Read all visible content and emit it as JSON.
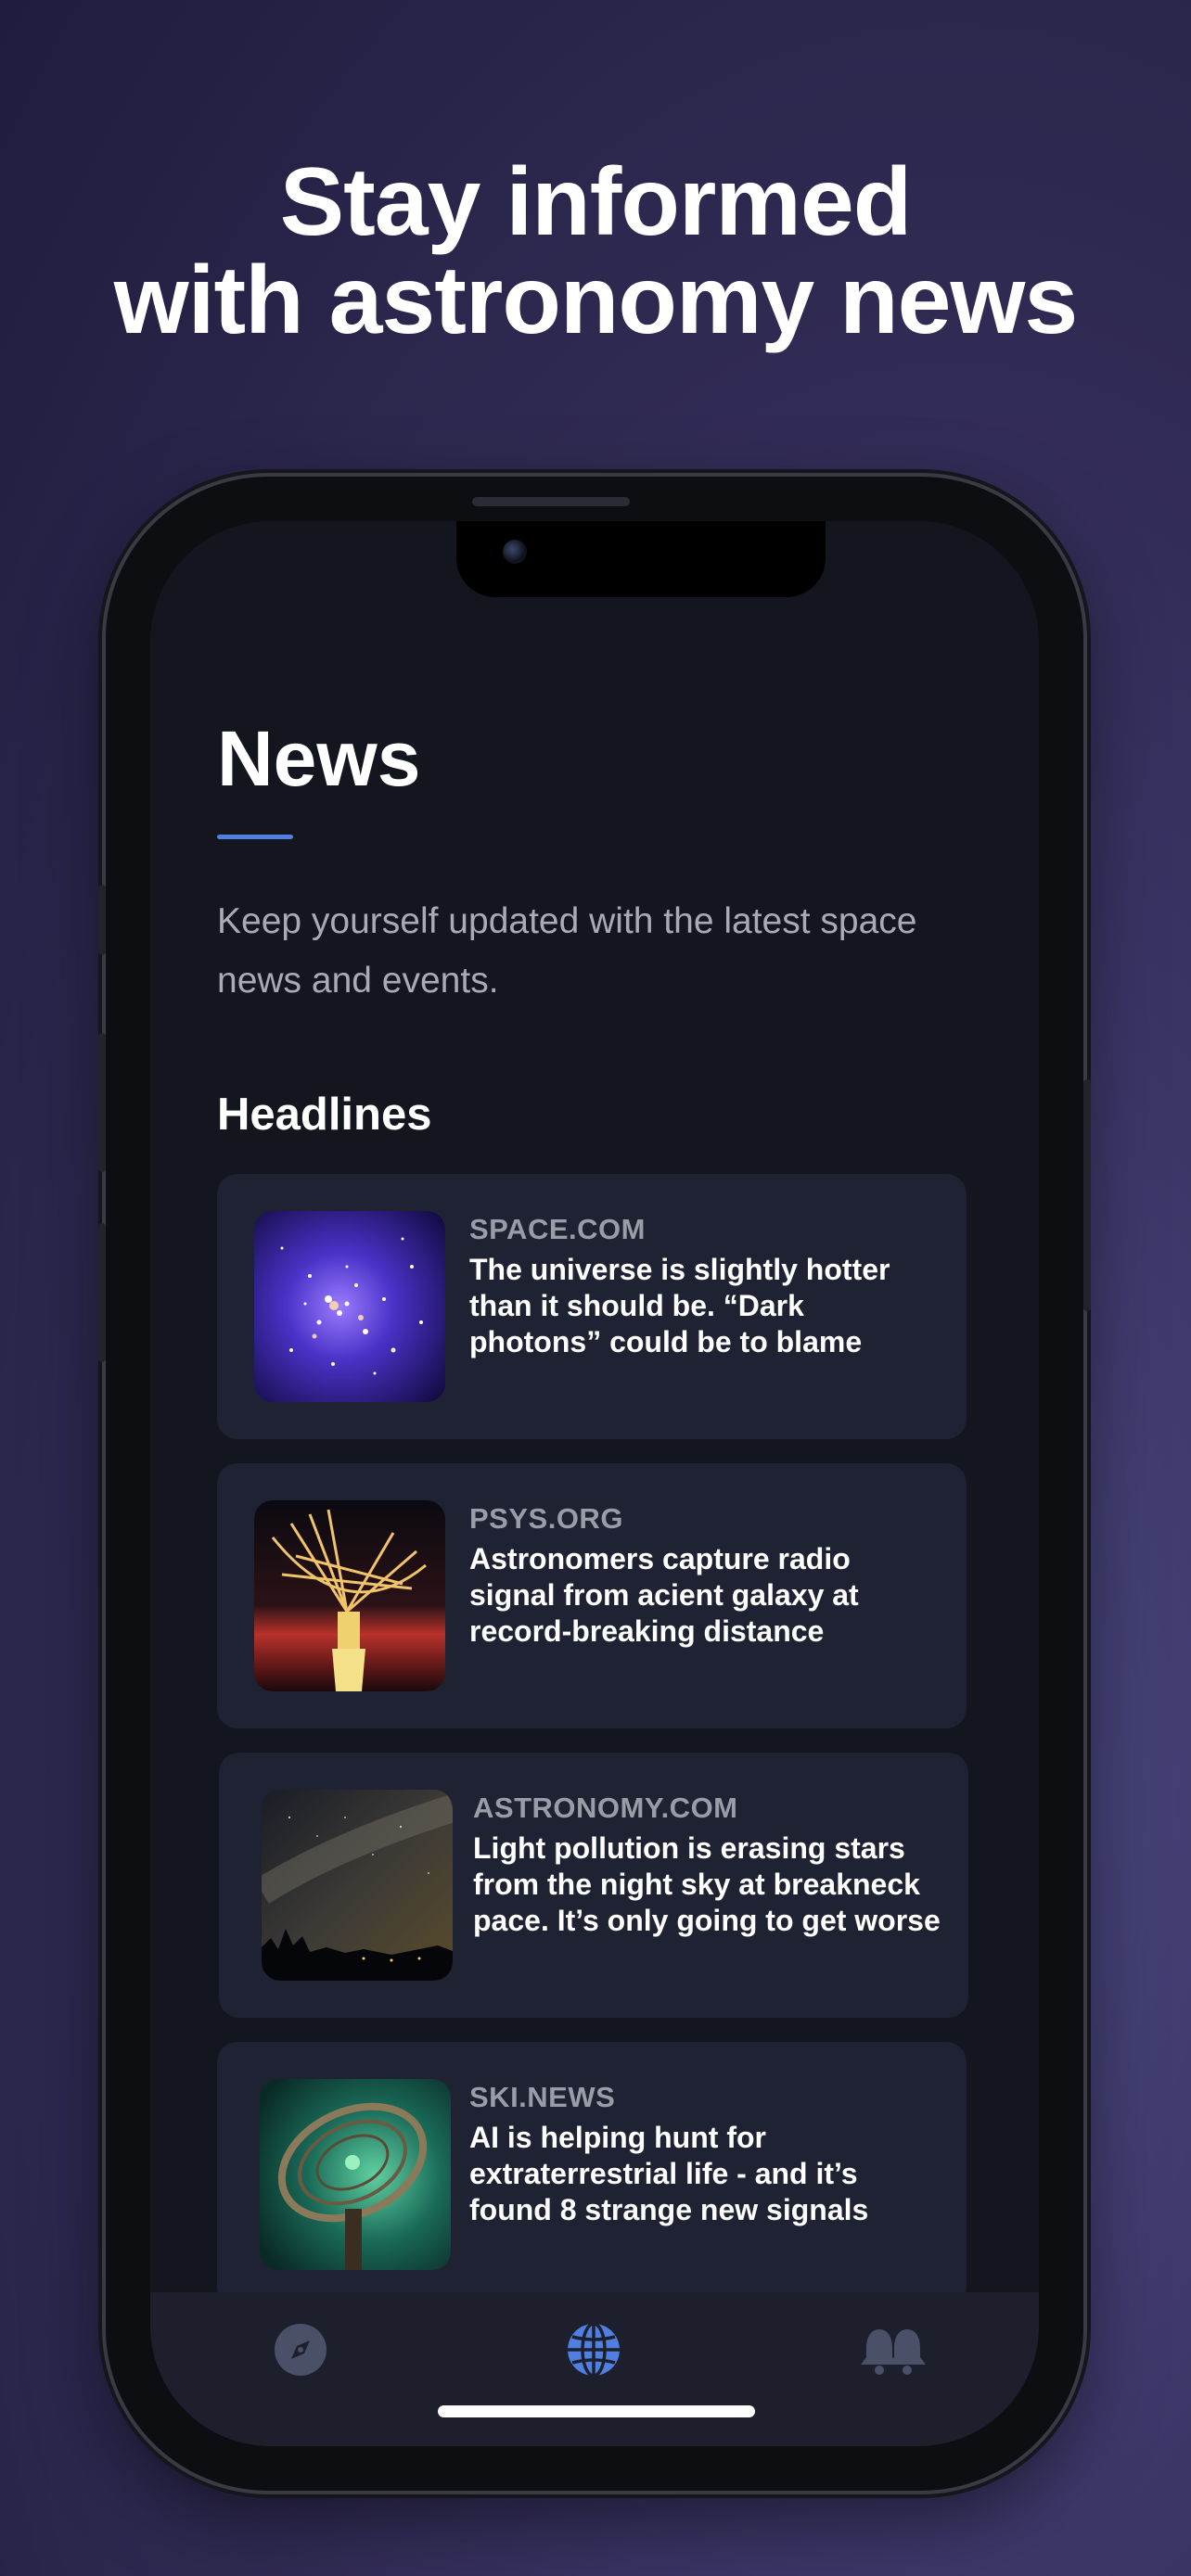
{
  "headline": {
    "line1": "Stay informed",
    "line2": "with astronomy news"
  },
  "screen": {
    "title": "News",
    "subtitle": "Keep yourself updated with the latest space news and events.",
    "section_title": "Headlines",
    "articles": [
      {
        "source": "SPACE.COM",
        "title": "The universe is slightly hotter than it should be. “Dark photons” could be to blame",
        "thumbnail": "galaxy-cluster"
      },
      {
        "source": "PSYS.ORG",
        "title": "Astronomers capture radio signal from acient galaxy at record-breaking distance",
        "thumbnail": "radio-telescope"
      },
      {
        "source": "ASTRONOMY.COM",
        "title": "Light pollution is erasing stars from the night sky at breakneck pace. It’s only going to get worse",
        "thumbnail": "milky-way-night"
      },
      {
        "source": "SKI.NEWS",
        "title": "AI is helping hunt for extraterrestrial life - and it’s found 8 strange new signals",
        "thumbnail": "green-dish"
      }
    ],
    "tabs": [
      {
        "icon": "compass-icon",
        "active": false
      },
      {
        "icon": "globe-icon",
        "active": true
      },
      {
        "icon": "bell-icon",
        "active": false
      }
    ]
  },
  "colors": {
    "accent": "#4f7fe0",
    "screen_bg": "#14161f",
    "card_bg": "#1f2232",
    "inactive_icon": "#4a5068"
  }
}
